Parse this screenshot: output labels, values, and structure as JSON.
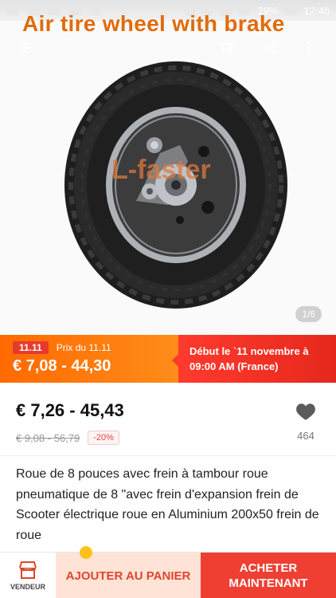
{
  "status_bar": {
    "battery": "29%",
    "time": "12:46",
    "signal_icons": [
      "youtube-icon",
      "mail-icon",
      "image-icon",
      "message-icon",
      "wifi-icon",
      "signal-icon",
      "bluetooth-icon",
      "alarm-icon",
      "plus-icon"
    ]
  },
  "hero": {
    "title": "Air tire wheel with brake",
    "watermark": "L-faster",
    "page_indicator": "1/6"
  },
  "promo": {
    "tag": "11.11",
    "label": "Prix du 11.11",
    "price_range": "€ 7,08 - 44,30",
    "notice": "Début le `11 novembre à 09:00 AM (France)"
  },
  "price": {
    "current": "€ 7,26 - 45,43",
    "original": "€ 9,08 - 56,79",
    "discount": "-20%"
  },
  "wishlist": {
    "count": "464"
  },
  "description": "Roue de 8 pouces avec frein à tambour roue pneumatique de 8 \"avec frein d'expansion frein de Scooter électrique roue en Aluminium 200x50 frein de roue",
  "bottom_bar": {
    "seller_label": "VENDEUR",
    "add_to_cart_label": "AJOUTER AU PANIER",
    "buy_now_label": "ACHETER MAINTENANT"
  },
  "colors": {
    "accent_orange": "#e06c0b",
    "promo_orange": "#ff6a00",
    "promo_red": "#ff3a2e",
    "buy_red": "#ef3f33",
    "add_cart_bg": "#ffe3d6"
  }
}
